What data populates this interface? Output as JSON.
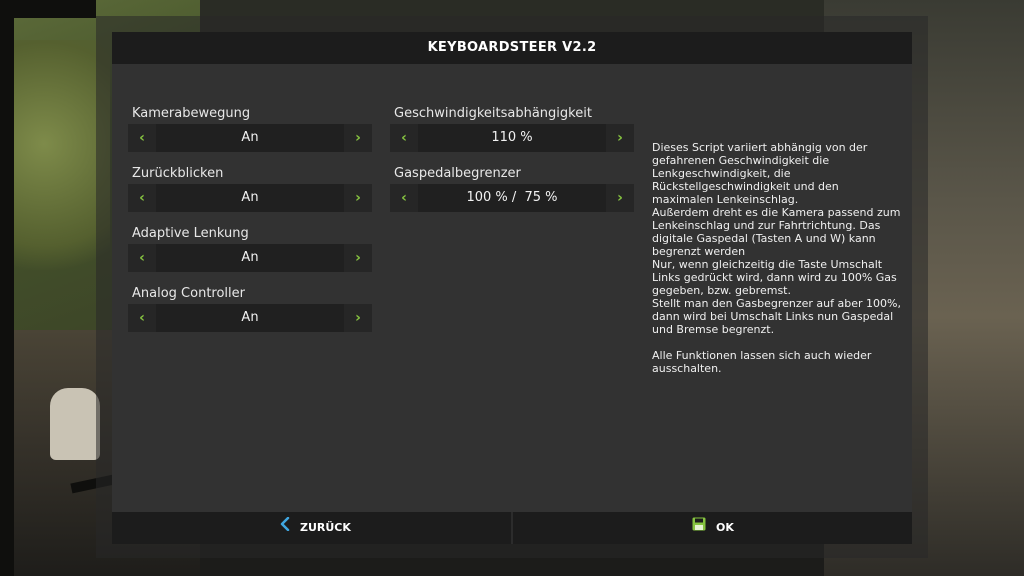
{
  "dialog": {
    "title": "KEYBOARDSTEER V2.2",
    "accent_color": "#86c440"
  },
  "settings_left": [
    {
      "label": "Kamerabewegung",
      "value": "An"
    },
    {
      "label": "Zurückblicken",
      "value": "An"
    },
    {
      "label": "Adaptive Lenkung",
      "value": "An"
    },
    {
      "label": "Analog Controller",
      "value": "An"
    }
  ],
  "settings_right": [
    {
      "label": "Geschwindigkeitsabhängigkeit",
      "value": "110 %"
    },
    {
      "label": "Gaspedalbegrenzer",
      "value": "100 % /  75 %"
    }
  ],
  "arrows": {
    "left": "‹",
    "right": "›"
  },
  "description": {
    "lines": [
      "Dieses Script variiert abhängig von der",
      "gefahrenen Geschwindigkeit die",
      "Lenkgeschwindigkeit, die",
      "Rückstellgeschwindigkeit und den",
      "maximalen Lenkeinschlag.",
      "Außerdem dreht es die Kamera passend zum",
      "Lenkeinschlag und zur Fahrtrichtung. Das",
      "digitale Gaspedal (Tasten A und W) kann",
      "begrenzt werden",
      "Nur, wenn gleichzeitig die Taste Umschalt",
      "Links gedrückt wird, dann wird zu 100% Gas",
      "gegeben, bzw. gebremst.",
      "Stellt man den Gasbegrenzer auf aber 100%,",
      "dann wird bei Umschalt Links nun Gaspedal",
      "und Bremse begrenzt.",
      "",
      "Alle Funktionen lassen sich auch wieder",
      "ausschalten."
    ]
  },
  "footer": {
    "back_label": "ZURÜCK",
    "ok_label": "OK",
    "back_icon": "chevron-left-icon",
    "ok_icon": "save-disk-icon"
  }
}
